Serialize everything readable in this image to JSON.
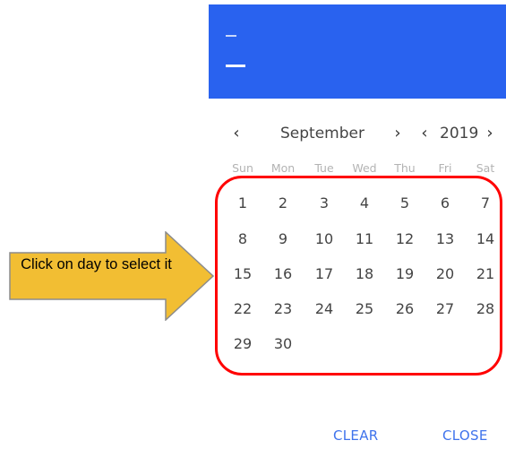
{
  "header": {
    "background": "#2962ef"
  },
  "navigation": {
    "month_label": "September",
    "year_label": "2019",
    "prev_month_glyph": "‹",
    "next_month_glyph": "›",
    "prev_year_glyph": "‹",
    "next_year_glyph": "›"
  },
  "weekdays": [
    "Sun",
    "Mon",
    "Tue",
    "Wed",
    "Thu",
    "Fri",
    "Sat"
  ],
  "days": [
    [
      "1",
      "2",
      "3",
      "4",
      "5",
      "6",
      "7"
    ],
    [
      "8",
      "9",
      "10",
      "11",
      "12",
      "13",
      "14"
    ],
    [
      "15",
      "16",
      "17",
      "18",
      "19",
      "20",
      "21"
    ],
    [
      "22",
      "23",
      "24",
      "25",
      "26",
      "27",
      "28"
    ],
    [
      "29",
      "30",
      "",
      "",
      "",
      "",
      ""
    ]
  ],
  "annotation": {
    "text": "Click on day to select it",
    "arrow_color": "#f2be33",
    "ring_color": "#ff0000"
  },
  "footer": {
    "clear_label": "CLEAR",
    "close_label": "CLOSE",
    "accent": "#3f73ec"
  }
}
